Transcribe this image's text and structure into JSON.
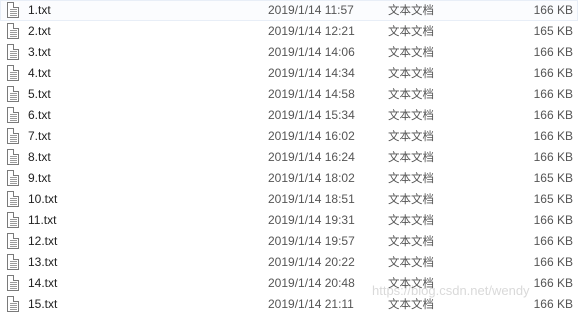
{
  "files": [
    {
      "name": "1.txt",
      "date": "2019/1/14 11:57",
      "type": "文本文档",
      "size": "166 KB"
    },
    {
      "name": "2.txt",
      "date": "2019/1/14 12:21",
      "type": "文本文档",
      "size": "165 KB"
    },
    {
      "name": "3.txt",
      "date": "2019/1/14 14:06",
      "type": "文本文档",
      "size": "166 KB"
    },
    {
      "name": "4.txt",
      "date": "2019/1/14 14:34",
      "type": "文本文档",
      "size": "166 KB"
    },
    {
      "name": "5.txt",
      "date": "2019/1/14 14:58",
      "type": "文本文档",
      "size": "166 KB"
    },
    {
      "name": "6.txt",
      "date": "2019/1/14 15:34",
      "type": "文本文档",
      "size": "166 KB"
    },
    {
      "name": "7.txt",
      "date": "2019/1/14 16:02",
      "type": "文本文档",
      "size": "166 KB"
    },
    {
      "name": "8.txt",
      "date": "2019/1/14 16:24",
      "type": "文本文档",
      "size": "166 KB"
    },
    {
      "name": "9.txt",
      "date": "2019/1/14 18:02",
      "type": "文本文档",
      "size": "165 KB"
    },
    {
      "name": "10.txt",
      "date": "2019/1/14 18:51",
      "type": "文本文档",
      "size": "165 KB"
    },
    {
      "name": "11.txt",
      "date": "2019/1/14 19:31",
      "type": "文本文档",
      "size": "166 KB"
    },
    {
      "name": "12.txt",
      "date": "2019/1/14 19:57",
      "type": "文本文档",
      "size": "166 KB"
    },
    {
      "name": "13.txt",
      "date": "2019/1/14 20:22",
      "type": "文本文档",
      "size": "166 KB"
    },
    {
      "name": "14.txt",
      "date": "2019/1/14 20:48",
      "type": "文本文档",
      "size": "166 KB"
    },
    {
      "name": "15.txt",
      "date": "2019/1/14 21:11",
      "type": "文本文档",
      "size": "166 KB"
    }
  ],
  "file_icon": "text-document-icon",
  "watermark": "https://blog.csdn.net/wendy"
}
